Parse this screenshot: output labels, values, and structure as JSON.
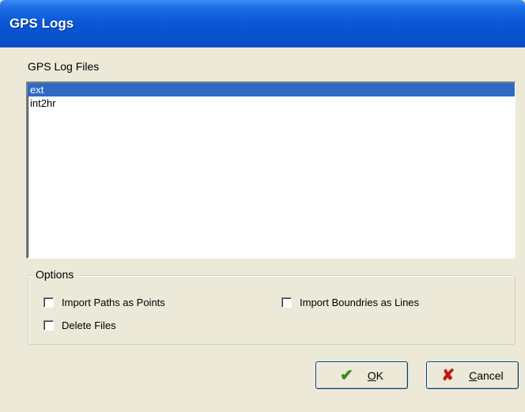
{
  "window": {
    "title": "GPS Logs"
  },
  "log_files": {
    "label": "GPS Log Files",
    "items": [
      {
        "name": "ext",
        "selected": true
      },
      {
        "name": "int2hr",
        "selected": false
      }
    ]
  },
  "options": {
    "legend": "Options",
    "checkboxes": [
      {
        "label": "Import Paths as Points",
        "checked": false
      },
      {
        "label": "Import Boundries as Lines",
        "checked": false
      },
      {
        "label": "Delete Files",
        "checked": false
      }
    ]
  },
  "buttons": {
    "ok_label": "OK",
    "cancel_label": "Cancel",
    "ok_icon": "checkmark-icon",
    "cancel_icon": "x-icon"
  },
  "colors": {
    "titlebar": "#0a58d8",
    "selection": "#316ac5",
    "dialog_bg": "#ece9d8"
  }
}
